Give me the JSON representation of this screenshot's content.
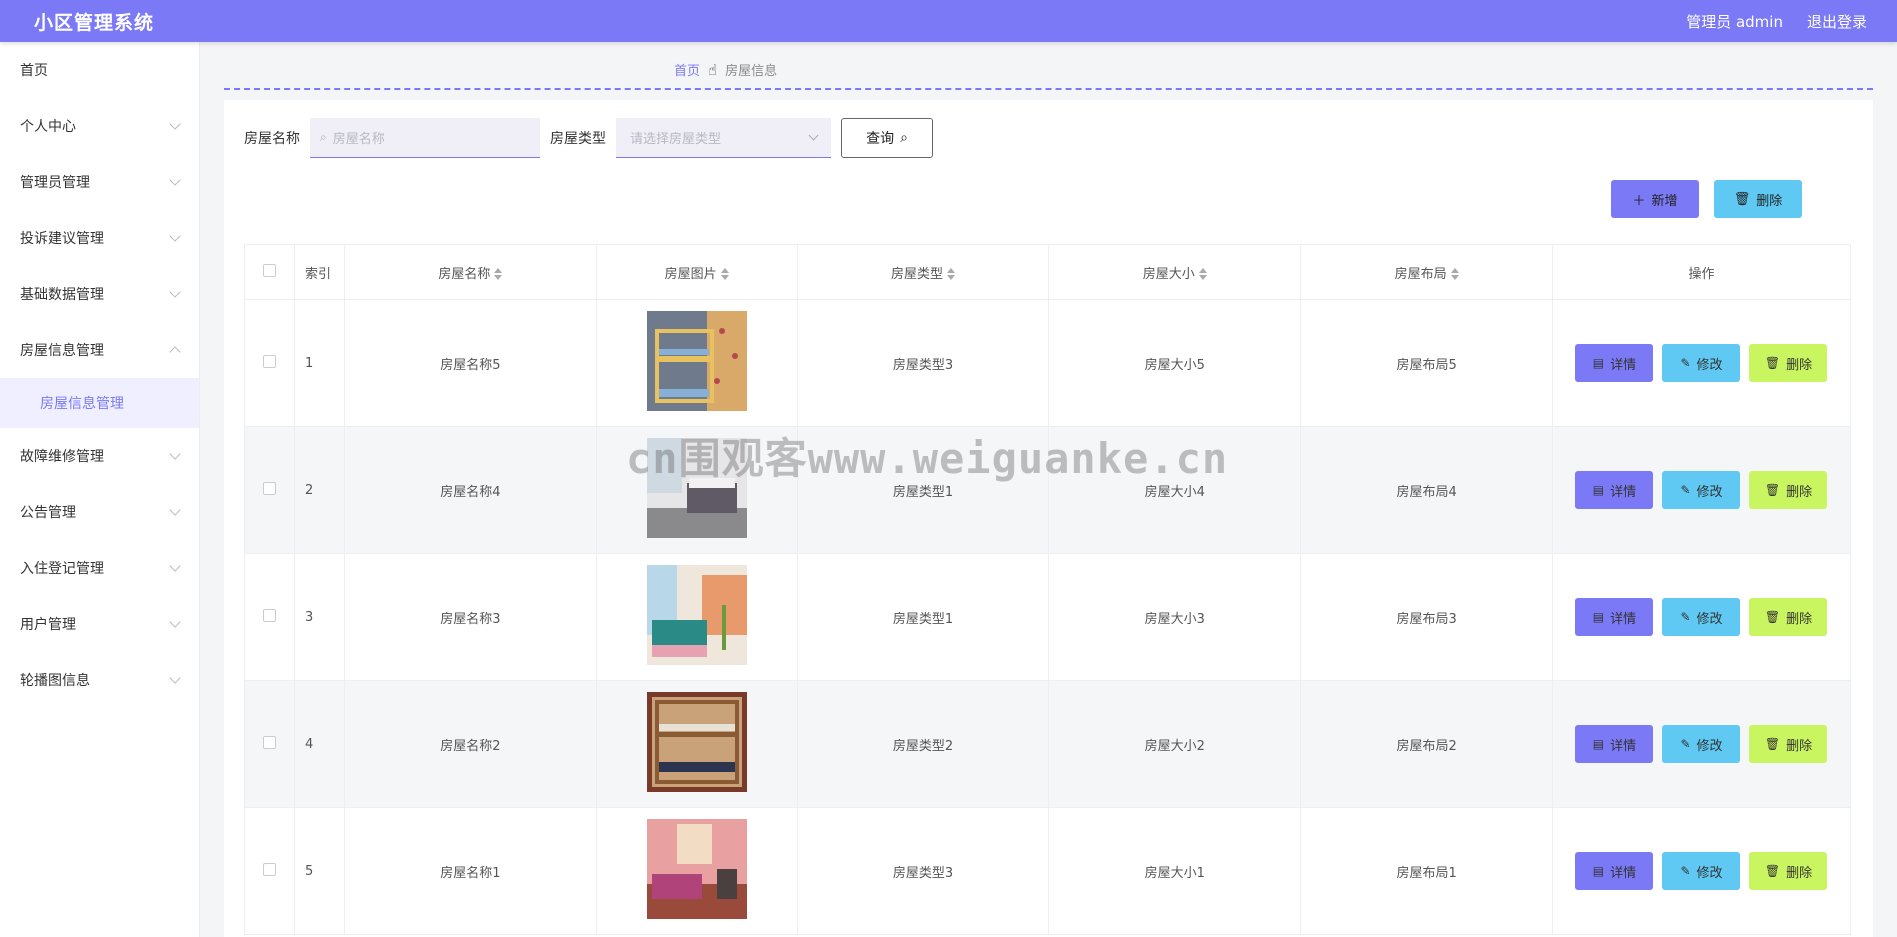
{
  "header": {
    "title": "小区管理系统",
    "user": "管理员 admin",
    "logout": "退出登录"
  },
  "sidebar": {
    "items": [
      {
        "label": "首页",
        "chevron": "none"
      },
      {
        "label": "个人中心",
        "chevron": "down"
      },
      {
        "label": "管理员管理",
        "chevron": "down"
      },
      {
        "label": "投诉建议管理",
        "chevron": "down"
      },
      {
        "label": "基础数据管理",
        "chevron": "down"
      },
      {
        "label": "房屋信息管理",
        "chevron": "up"
      },
      {
        "label": "故障维修管理",
        "chevron": "down"
      },
      {
        "label": "公告管理",
        "chevron": "down"
      },
      {
        "label": "入住登记管理",
        "chevron": "down"
      },
      {
        "label": "用户管理",
        "chevron": "down"
      },
      {
        "label": "轮播图信息",
        "chevron": "down"
      }
    ],
    "active_sub": "房屋信息管理"
  },
  "breadcrumb": {
    "home": "首页",
    "current": "房屋信息"
  },
  "search": {
    "name_label": "房屋名称",
    "name_placeholder": "房屋名称",
    "type_label": "房屋类型",
    "type_placeholder": "请选择房屋类型",
    "query_label": "查询"
  },
  "actions": {
    "add_label": "新增",
    "delete_label": "删除"
  },
  "table": {
    "headers": {
      "index": "索引",
      "name": "房屋名称",
      "image": "房屋图片",
      "type": "房屋类型",
      "size": "房屋大小",
      "layout": "房屋布局",
      "ops": "操作"
    },
    "op_labels": {
      "detail": "详情",
      "edit": "修改",
      "remove": "删除"
    },
    "rows": [
      {
        "index": "1",
        "name": "房屋名称5",
        "type": "房屋类型3",
        "size": "房屋大小5",
        "layout": "房屋布局5"
      },
      {
        "index": "2",
        "name": "房屋名称4",
        "type": "房屋类型1",
        "size": "房屋大小4",
        "layout": "房屋布局4"
      },
      {
        "index": "3",
        "name": "房屋名称3",
        "type": "房屋类型1",
        "size": "房屋大小3",
        "layout": "房屋布局3"
      },
      {
        "index": "4",
        "name": "房屋名称2",
        "type": "房屋类型2",
        "size": "房屋大小2",
        "layout": "房屋布局2"
      },
      {
        "index": "5",
        "name": "房屋名称1",
        "type": "房屋类型3",
        "size": "房屋大小1",
        "layout": "房屋布局1"
      }
    ]
  },
  "watermark": "cn围观客www.weiguanke.cn",
  "colors": {
    "primary": "#7b79f6",
    "info": "#5fc8f3",
    "lime": "#c9f560"
  }
}
